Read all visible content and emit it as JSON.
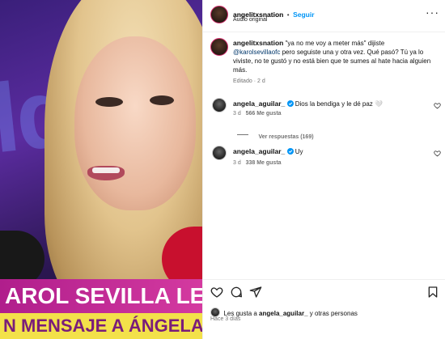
{
  "video": {
    "banner_line1": "AROL SEVILLA LE MA",
    "banner_line2": "N MENSAJE A ÁNGELA AG"
  },
  "header": {
    "username": "angelitxsnation",
    "separator": "•",
    "follow_label": "Seguir",
    "audio_label": "Audio original",
    "more_icon": "more-horizontal-icon"
  },
  "caption": {
    "username": "angelitxsnation",
    "text_part1": "\"ya no me voy a meter más\" dijiste",
    "mention": "@karolsevillaofc",
    "text_part2": " pero seguiste una y otra vez. Qué pasó? Tú ya lo viviste, no te gustó y no está bien que te sumes al hate hacia alguien más.",
    "edited_label": "Editado",
    "separator": "·",
    "time": "2 d"
  },
  "comments": [
    {
      "username": "angela_aguilar_",
      "text": "Dios la bendiga y le dé paz 🤍",
      "time": "3 d",
      "likes": "566 Me gusta",
      "replies_label": "Ver respuestas (169)"
    },
    {
      "username": "angela_aguilar_",
      "text": "Uy",
      "time": "3 d",
      "likes": "338 Me gusta"
    }
  ],
  "footer": {
    "likes_prefix": "Les gusta a ",
    "likes_user": "angela_aguilar_",
    "likes_suffix": " y otras personas",
    "time_ago": "Hace 3 días"
  },
  "colors": {
    "accent": "#0095f6",
    "verified": "#0095f6",
    "subtle_text": "#737373"
  }
}
